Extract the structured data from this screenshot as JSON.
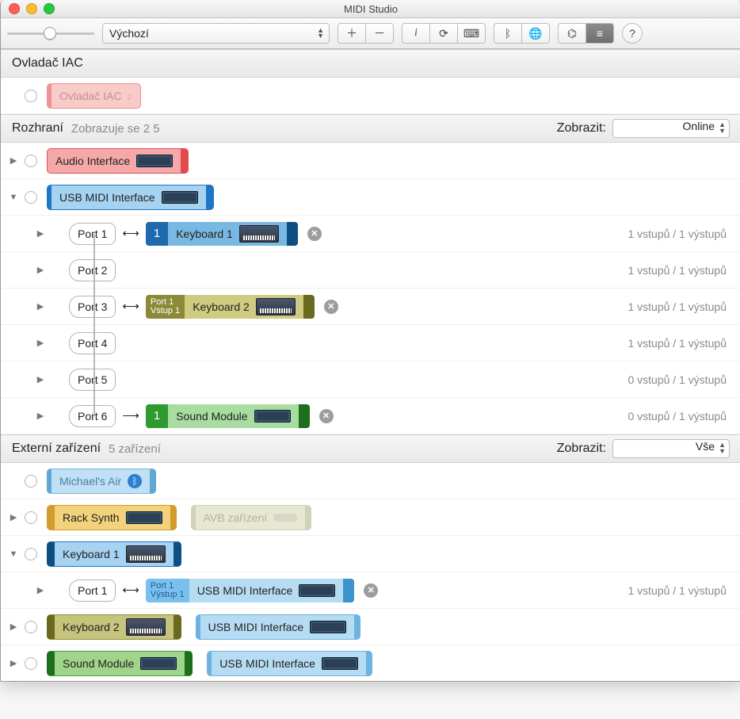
{
  "window": {
    "title": "MIDI Studio"
  },
  "toolbar": {
    "config_dropdown": "Výchozí"
  },
  "sections": {
    "iac": {
      "title": "Ovladač IAC",
      "device": "Ovladač IAC"
    },
    "interfaces": {
      "title": "Rozhraní",
      "count": "Zobrazuje se 2 5",
      "filter_label": "Zobrazit:",
      "filter_value": "Online",
      "audio_if": "Audio Interface",
      "usb_if": "USB MIDI Interface",
      "ports": {
        "p1": "Port 1",
        "p2": "Port 2",
        "p3": "Port 3",
        "p4": "Port 4",
        "p5": "Port 5",
        "p6": "Port 6"
      },
      "kbd1": {
        "side": "1",
        "label": "Keyboard 1"
      },
      "kbd2": {
        "side": "Port 1\nVstup 1",
        "label": "Keyboard 2"
      },
      "sm": {
        "side": "1",
        "label": "Sound Module"
      },
      "meta11": "1 vstupů / 1 výstupů",
      "meta01": "0 vstupů / 1 výstupů"
    },
    "ext": {
      "title": "Externí zařízení",
      "count": "5 zařízení",
      "filter_label": "Zobrazit:",
      "filter_value": "Vše",
      "air": "Michael's Air",
      "rack": "Rack Synth",
      "avb": "AVB zařízení",
      "kbd1": "Keyboard 1",
      "kbd2": "Keyboard 2",
      "sm": "Sound Module",
      "usb_if": "USB MIDI Interface",
      "port1": "Port 1",
      "chip_side": "Port 1\nVýstup 1",
      "meta11": "1 vstupů / 1 výstupů"
    }
  }
}
